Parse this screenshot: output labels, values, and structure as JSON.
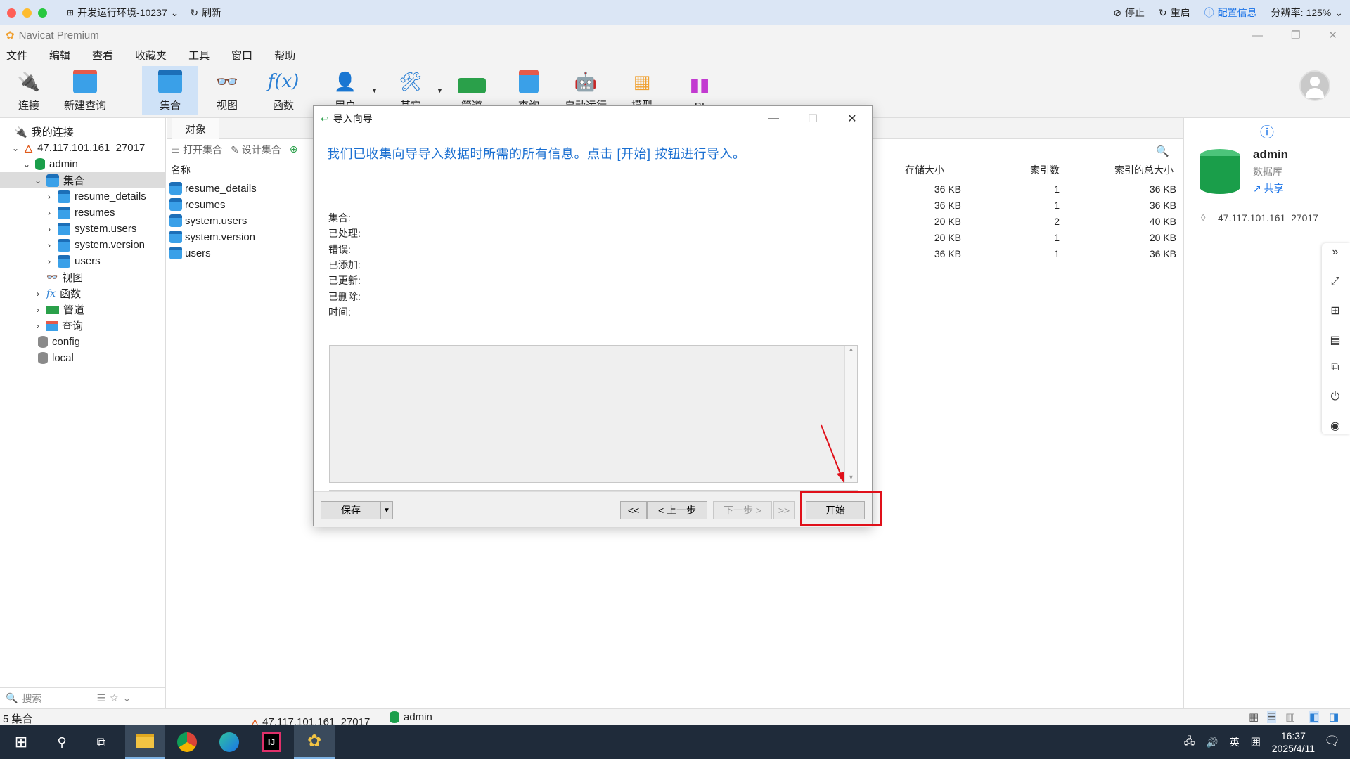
{
  "host_bar": {
    "env_name": "开发运行环境-10237",
    "refresh": "刷新",
    "stop": "停止",
    "restart": "重启",
    "config_info": "配置信息",
    "resolution": "分辨率: 125%"
  },
  "app": {
    "title": "Navicat Premium"
  },
  "menu": [
    "文件",
    "编辑",
    "查看",
    "收藏夹",
    "工具",
    "窗口",
    "帮助"
  ],
  "toolbar": {
    "connect": "连接",
    "new_query": "新建查询",
    "collection": "集合",
    "view": "视图",
    "function": "函数",
    "user": "用户",
    "other": "其它",
    "pipeline": "管道",
    "query": "查询",
    "auto_run": "自动运行",
    "model": "模型",
    "bi": "BI"
  },
  "tree": {
    "my_connections": "我的连接",
    "connection": "47.117.101.161_27017",
    "db_admin": "admin",
    "collections_folder": "集合",
    "collections": [
      "resume_details",
      "resumes",
      "system.users",
      "system.version",
      "users"
    ],
    "views": "视图",
    "functions": "函数",
    "pipelines": "管道",
    "queries": "查询",
    "db_config": "config",
    "db_local": "local",
    "search_placeholder": "搜索"
  },
  "objects": {
    "tab": "对象",
    "open_collection": "打开集合",
    "design_collection": "设计集合",
    "columns": {
      "name": "名称",
      "storage_size": "存储大小",
      "index_count": "索引数",
      "total_index_size": "索引的总大小"
    },
    "rows": [
      {
        "name": "resume_details",
        "storage": "36 KB",
        "indexes": "1",
        "index_size": "36 KB"
      },
      {
        "name": "resumes",
        "storage": "36 KB",
        "indexes": "1",
        "index_size": "36 KB"
      },
      {
        "name": "system.users",
        "storage": "20 KB",
        "indexes": "2",
        "index_size": "40 KB"
      },
      {
        "name": "system.version",
        "storage": "20 KB",
        "indexes": "1",
        "index_size": "20 KB"
      },
      {
        "name": "users",
        "storage": "36 KB",
        "indexes": "1",
        "index_size": "36 KB"
      }
    ]
  },
  "info": {
    "db_name": "admin",
    "db_type": "数据库",
    "share": "共享",
    "connection": "47.117.101.161_27017"
  },
  "status": {
    "count": "5 集合",
    "connection": "47.117.101.161_27017",
    "db": "admin"
  },
  "dialog": {
    "title": "导入向导",
    "message": "我们已收集向导导入数据时所需的所有信息。点击 [开始] 按钮进行导入。",
    "stats": [
      "集合:",
      "已处理:",
      "错误:",
      "已添加:",
      "已更新:",
      "已删除:",
      "时间:"
    ],
    "save": "保存",
    "first": "<<",
    "prev": "< 上一步",
    "next": "下一步 >",
    "last": ">>",
    "start": "开始"
  },
  "taskbar": {
    "ime_lang": "英",
    "ime_mode": "囲",
    "time": "16:37",
    "date": "2025/4/11"
  },
  "colors": {
    "accent": "#1a6fd1",
    "highlight_red": "#e0101a",
    "db_green": "#1a9e4a"
  }
}
